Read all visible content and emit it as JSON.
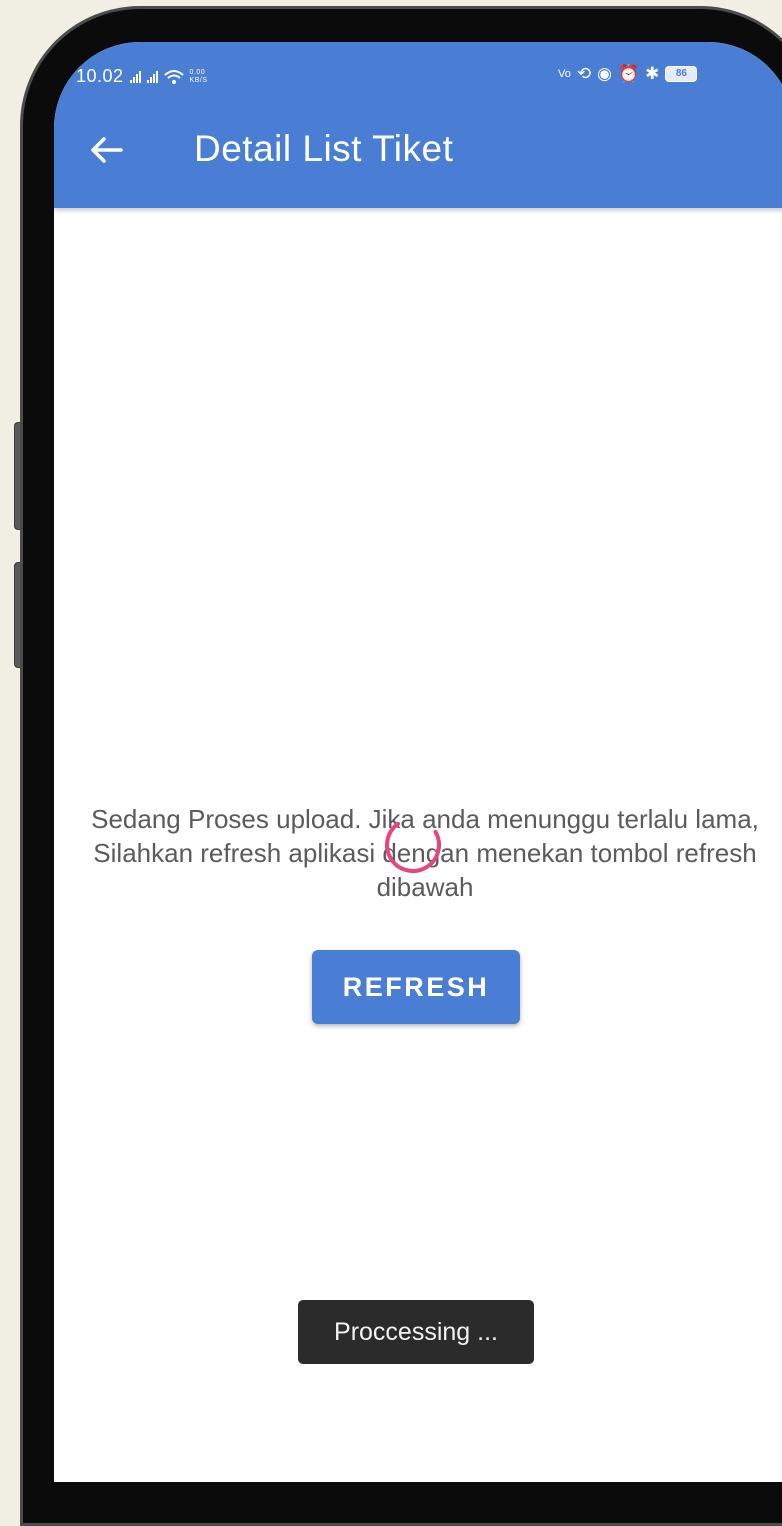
{
  "status_bar": {
    "time": "10.02",
    "speed": "0.00 KB/S",
    "battery": "86"
  },
  "app_bar": {
    "title": "Detail List Tiket"
  },
  "main": {
    "message": "Sedang Proses upload. Jika anda menunggu terlalu lama, Silahkan refresh aplikasi dengan menekan tombol refresh dibawah",
    "refresh_label": "REFRESH"
  },
  "toast": {
    "text": "Proccessing ..."
  },
  "icons": {
    "back": "arrow-back-icon",
    "spinner": "loading-spinner-icon"
  },
  "colors": {
    "primary": "#4a7ed4",
    "spinner": "#e8457a",
    "toast_bg": "#2b2b2b",
    "background": "#f1eee3"
  }
}
